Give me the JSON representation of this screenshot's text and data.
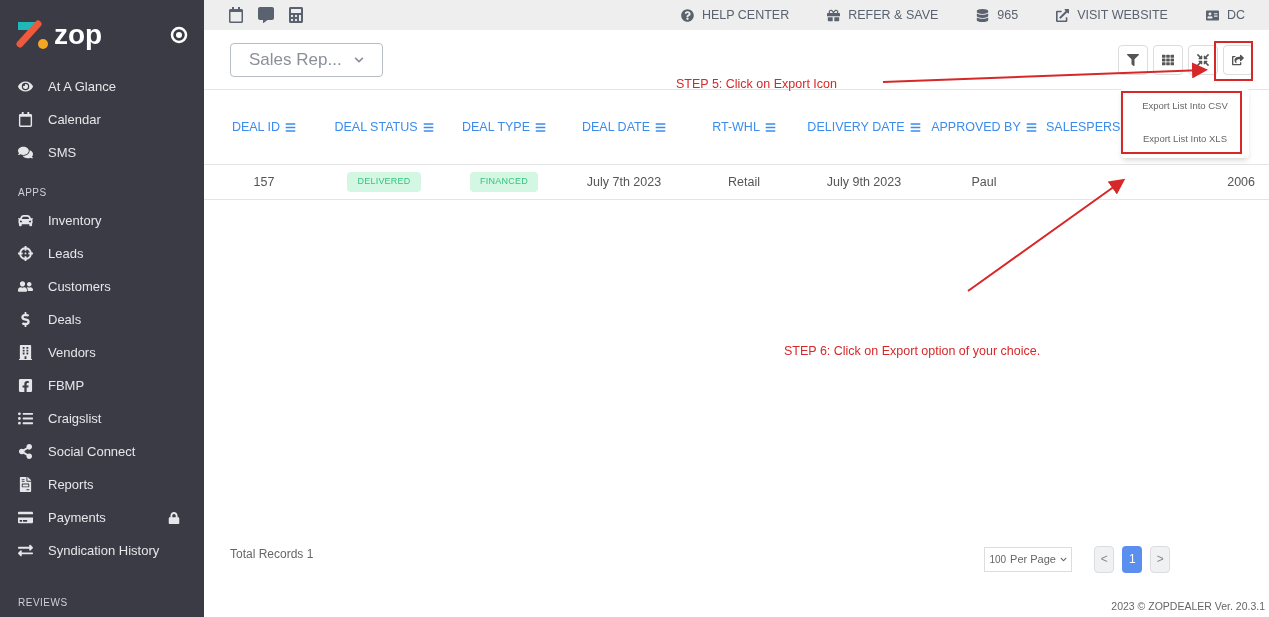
{
  "sidebar": {
    "logo": "zop",
    "items": [
      {
        "label": "At A Glance"
      },
      {
        "label": "Calendar"
      },
      {
        "label": "SMS"
      }
    ],
    "apps_heading": "APPS",
    "apps": [
      {
        "label": "Inventory",
        "locked": false
      },
      {
        "label": "Leads",
        "locked": false
      },
      {
        "label": "Customers",
        "locked": false
      },
      {
        "label": "Deals",
        "locked": false
      },
      {
        "label": "Vendors",
        "locked": false
      },
      {
        "label": "FBMP",
        "locked": false
      },
      {
        "label": "Craigslist",
        "locked": false
      },
      {
        "label": "Social Connect",
        "locked": false
      },
      {
        "label": "Reports",
        "locked": false
      },
      {
        "label": "Payments",
        "locked": true
      },
      {
        "label": "Syndication History",
        "locked": false
      }
    ],
    "reviews_heading": "REVIEWS"
  },
  "topbar": {
    "links": [
      {
        "label": "HELP CENTER"
      },
      {
        "label": "REFER & SAVE"
      },
      {
        "label": "965"
      },
      {
        "label": "VISIT WEBSITE"
      },
      {
        "label": "DC"
      }
    ]
  },
  "report_select": {
    "value": "Sales Rep..."
  },
  "export_menu": [
    "Export List Into CSV",
    "Export List Into XLS"
  ],
  "table": {
    "columns": [
      "DEAL ID",
      "DEAL STATUS",
      "DEAL TYPE",
      "DEAL DATE",
      "RT-WHL",
      "DELIVERY DATE",
      "APPROVED BY",
      "SALESPERS",
      ""
    ],
    "rows": [
      {
        "cells": [
          {
            "kind": "text",
            "text": "157"
          },
          {
            "kind": "badge",
            "text": "DELIVERED"
          },
          {
            "kind": "badge",
            "text": "FINANCED"
          },
          {
            "kind": "text",
            "text": "July 7th 2023"
          },
          {
            "kind": "text",
            "text": "Retail"
          },
          {
            "kind": "text",
            "text": "July 9th 2023"
          },
          {
            "kind": "text",
            "text": "Paul"
          },
          {
            "kind": "text",
            "text": ""
          },
          {
            "kind": "right",
            "text": "2006"
          }
        ]
      }
    ]
  },
  "total_records": "Total Records 1",
  "per_page": {
    "value": "100",
    "label": "Per Page"
  },
  "pagination": {
    "prev": "<",
    "next": ">",
    "pages": [
      {
        "label": "1",
        "selected": true
      }
    ]
  },
  "footer": "2023 © ZOPDEALER Ver. 20.3.1",
  "annotations": [
    {
      "text": "STEP 5: Click on Export Icon"
    },
    {
      "text": "STEP 6: Click on Export option of your choice."
    }
  ]
}
